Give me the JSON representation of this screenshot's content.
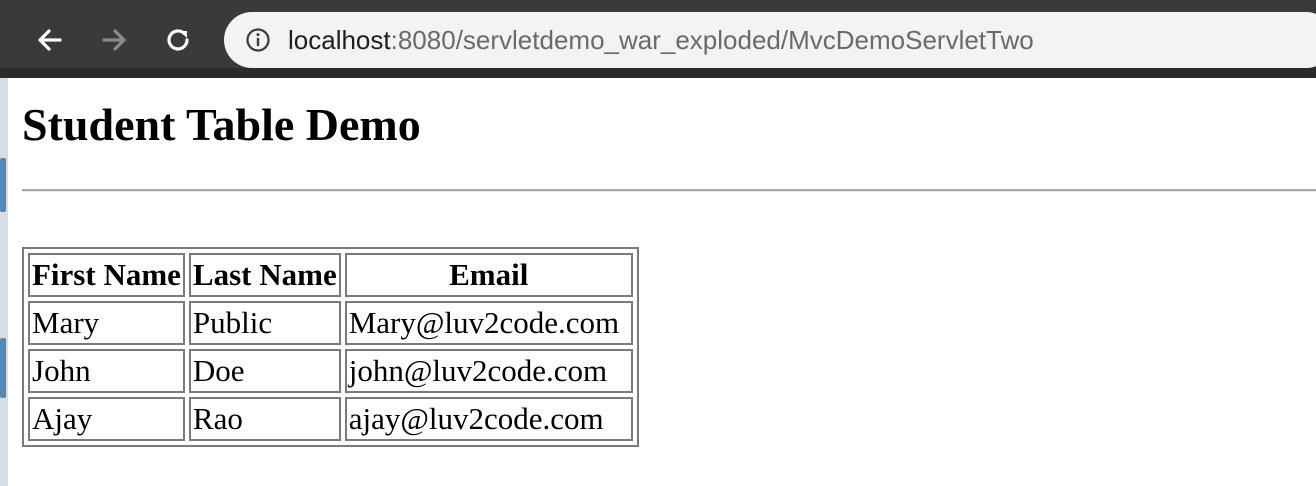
{
  "browser": {
    "url_host": "localhost",
    "url_rest": ":8080/servletdemo_war_exploded/MvcDemoServletTwo",
    "icons": {
      "back": "arrow-left-icon",
      "forward": "arrow-right-icon",
      "reload": "reload-icon",
      "info": "info-icon"
    }
  },
  "page": {
    "title": "Student Table Demo",
    "table": {
      "headers": [
        "First Name",
        "Last Name",
        "Email"
      ],
      "rows": [
        [
          "Mary",
          "Public",
          "Mary@luv2code.com"
        ],
        [
          "John",
          "Doe",
          "john@luv2code.com"
        ],
        [
          "Ajay",
          "Rao",
          "ajay@luv2code.com"
        ]
      ]
    }
  }
}
